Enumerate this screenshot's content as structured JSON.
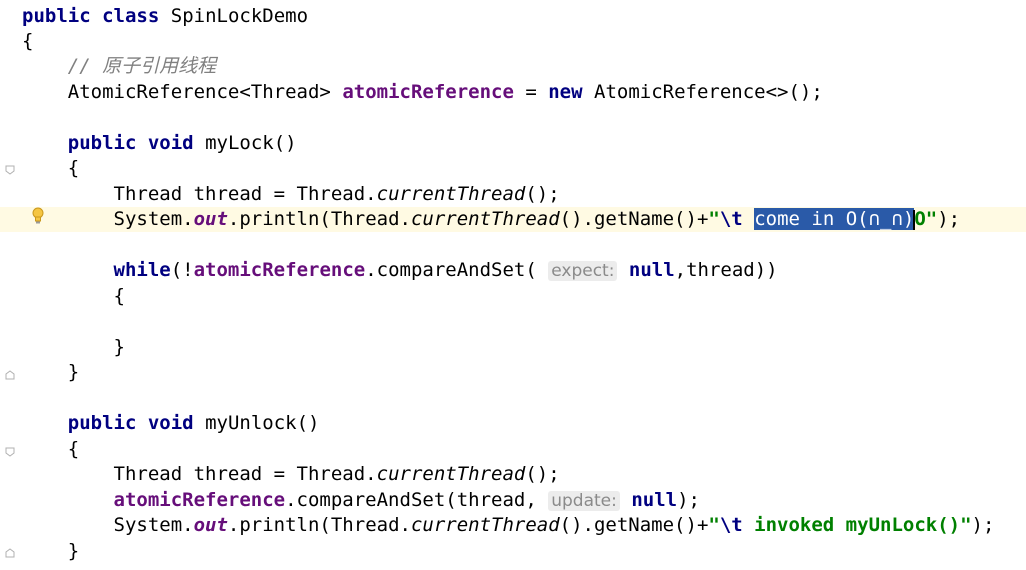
{
  "editor": {
    "lines": [
      {
        "id": "l1",
        "tokens": [
          [
            "kw",
            "public"
          ],
          [
            "sp",
            " "
          ],
          [
            "kw",
            "class"
          ],
          [
            "sp",
            " "
          ],
          [
            "pl",
            "SpinLockDemo"
          ]
        ]
      },
      {
        "id": "l2",
        "tokens": [
          [
            "pl",
            "{"
          ]
        ]
      },
      {
        "id": "l3",
        "tokens": [
          [
            "sp",
            "    "
          ],
          [
            "cmt",
            "// 原子引用线程"
          ]
        ]
      },
      {
        "id": "l4",
        "tokens": [
          [
            "sp",
            "    "
          ],
          [
            "pl",
            "AtomicReference<Thread> "
          ],
          [
            "fld",
            "atomicReference"
          ],
          [
            "pl",
            " = "
          ],
          [
            "kw",
            "new"
          ],
          [
            "pl",
            " AtomicReference<>();"
          ]
        ]
      },
      {
        "id": "l5",
        "tokens": []
      },
      {
        "id": "l6",
        "tokens": [
          [
            "sp",
            "    "
          ],
          [
            "kw",
            "public"
          ],
          [
            "sp",
            " "
          ],
          [
            "kw",
            "void"
          ],
          [
            "pl",
            " myLock()"
          ]
        ]
      },
      {
        "id": "l7",
        "tokens": [
          [
            "sp",
            "    "
          ],
          [
            "pl",
            "{"
          ]
        ]
      },
      {
        "id": "l8",
        "tokens": [
          [
            "sp",
            "        "
          ],
          [
            "pl",
            "Thread thread = Thread."
          ],
          [
            "st",
            "currentThread"
          ],
          [
            "pl",
            "();"
          ]
        ]
      },
      {
        "id": "l9",
        "tokens": [
          [
            "sp",
            "        "
          ],
          [
            "pl",
            "System."
          ],
          [
            "fst",
            "out"
          ],
          [
            "pl",
            ".println(Thread."
          ],
          [
            "st",
            "currentThread"
          ],
          [
            "pl",
            "().getName()+"
          ],
          [
            "str",
            "\""
          ],
          [
            "esc",
            "\\t"
          ],
          [
            "str",
            " "
          ],
          [
            "sel",
            "come in O(∩_∩)"
          ],
          [
            "caret",
            ""
          ],
          [
            "str",
            "O\""
          ],
          [
            "pl",
            ");"
          ]
        ]
      },
      {
        "id": "l10",
        "tokens": []
      },
      {
        "id": "l11",
        "tokens": [
          [
            "sp",
            "        "
          ],
          [
            "kw",
            "while"
          ],
          [
            "pl",
            "(!"
          ],
          [
            "fld",
            "atomicRe"
          ],
          [
            "fld",
            "ference"
          ],
          [
            "pl",
            ".compareAndSet( "
          ],
          [
            "hint",
            "expect:"
          ],
          [
            "pl",
            " "
          ],
          [
            "kw",
            "null"
          ],
          [
            "pl",
            ",thread))"
          ]
        ]
      },
      {
        "id": "l12",
        "tokens": [
          [
            "sp",
            "        "
          ],
          [
            "pl",
            "{"
          ]
        ]
      },
      {
        "id": "l13",
        "tokens": []
      },
      {
        "id": "l14",
        "tokens": [
          [
            "sp",
            "        "
          ],
          [
            "pl",
            "}"
          ]
        ]
      },
      {
        "id": "l15",
        "tokens": [
          [
            "sp",
            "    "
          ],
          [
            "pl",
            "}"
          ]
        ]
      },
      {
        "id": "l16",
        "tokens": []
      },
      {
        "id": "l17",
        "tokens": [
          [
            "sp",
            "    "
          ],
          [
            "kw",
            "public"
          ],
          [
            "sp",
            " "
          ],
          [
            "kw",
            "void"
          ],
          [
            "pl",
            " myUnlock()"
          ]
        ]
      },
      {
        "id": "l18",
        "tokens": [
          [
            "sp",
            "    "
          ],
          [
            "pl",
            "{"
          ]
        ]
      },
      {
        "id": "l19",
        "tokens": [
          [
            "sp",
            "        "
          ],
          [
            "pl",
            "Thread thread = Thread."
          ],
          [
            "st",
            "currentThread"
          ],
          [
            "pl",
            "();"
          ]
        ]
      },
      {
        "id": "l20",
        "tokens": [
          [
            "sp",
            "        "
          ],
          [
            "fld",
            "atomicReference"
          ],
          [
            "pl",
            ".compareAndSet(thread, "
          ],
          [
            "hint",
            "update:"
          ],
          [
            "pl",
            " "
          ],
          [
            "kw",
            "null"
          ],
          [
            "pl",
            ");"
          ]
        ]
      },
      {
        "id": "l21",
        "tokens": [
          [
            "sp",
            "        "
          ],
          [
            "pl",
            "System."
          ],
          [
            "fst",
            "out"
          ],
          [
            "pl",
            ".println(Thread."
          ],
          [
            "st",
            "currentThread"
          ],
          [
            "pl",
            "().getName()+"
          ],
          [
            "str",
            "\""
          ],
          [
            "esc",
            "\\t"
          ],
          [
            "str",
            " invoked myUnLock()\""
          ],
          [
            "pl",
            ");"
          ]
        ]
      },
      {
        "id": "l22",
        "tokens": [
          [
            "sp",
            "    "
          ],
          [
            "pl",
            "}"
          ]
        ]
      }
    ]
  },
  "colors": {
    "keyword": "#000080",
    "field": "#660e7a",
    "string": "#008000",
    "comment": "#808080",
    "selection": "#2a5aa8",
    "caret_line": "#fffae3"
  },
  "icons": [
    "lightbulb-icon",
    "fold-marker-icon"
  ]
}
